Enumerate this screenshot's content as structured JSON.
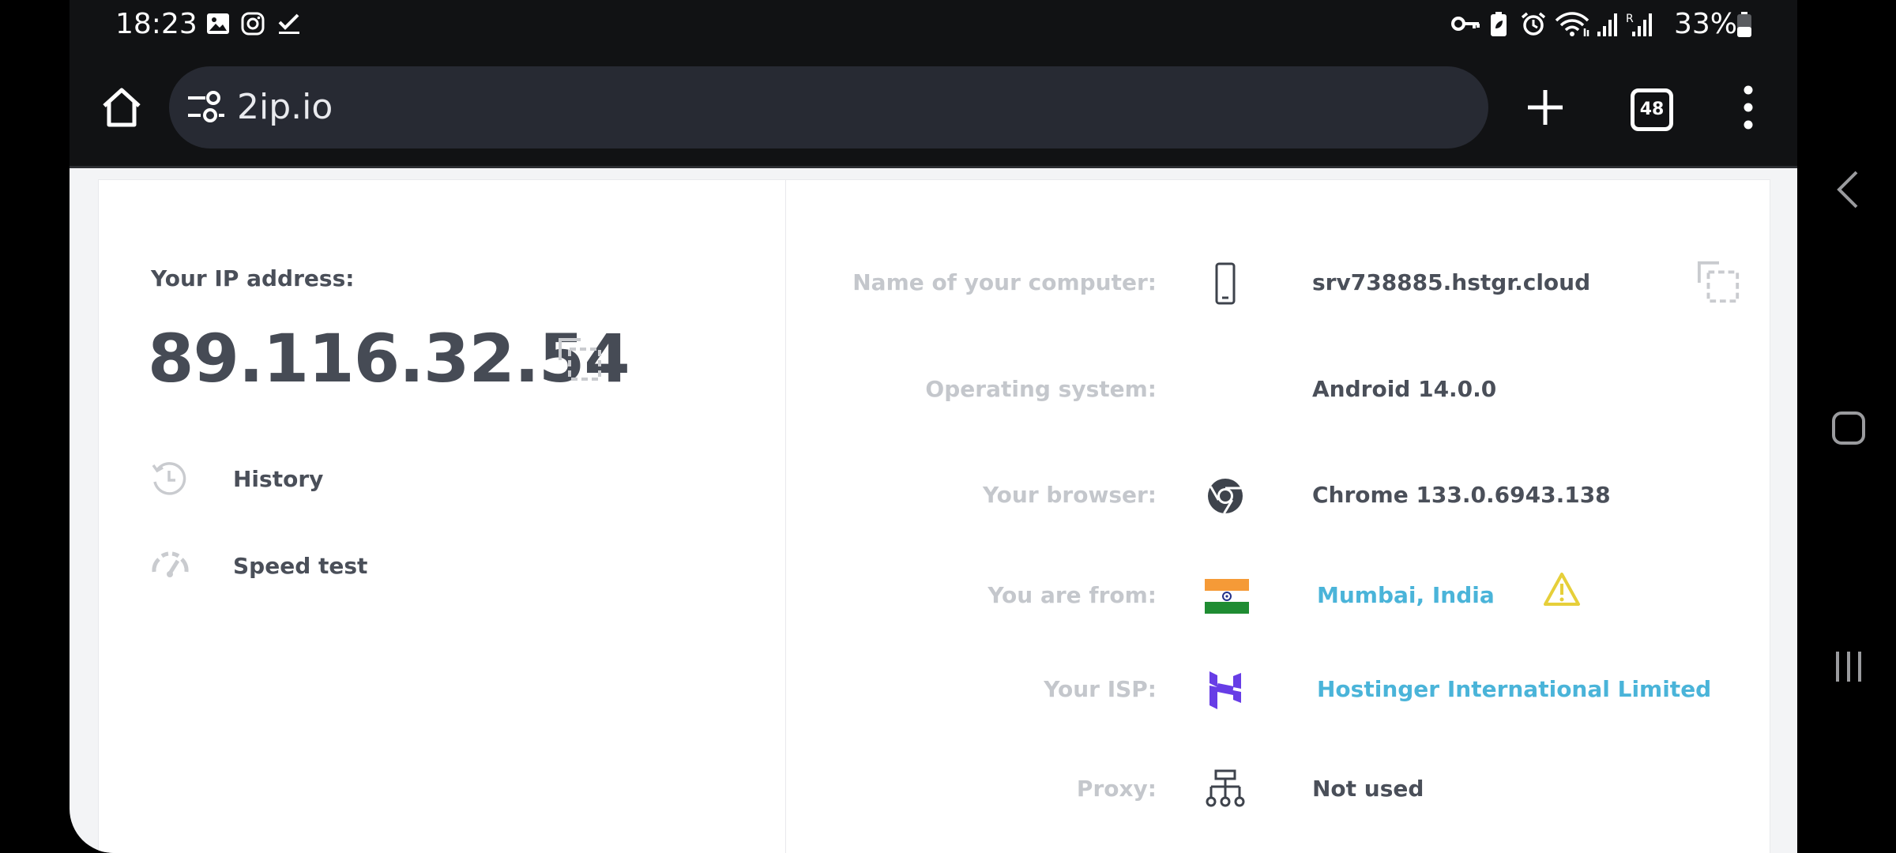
{
  "status_bar": {
    "time": "18:23",
    "battery": "33%",
    "icons": [
      "image-icon",
      "instagram-icon",
      "check-icon",
      "key-icon",
      "battery-saver-icon",
      "alarm-icon",
      "wifi-icon",
      "signal-icon",
      "signal-roaming-icon",
      "battery-icon"
    ]
  },
  "browser": {
    "url": "2ip.io",
    "tab_count": "48"
  },
  "ip_card": {
    "label": "Your IP address:",
    "ip": "89.116.32.54",
    "links": [
      {
        "label": "History",
        "icon": "history-icon"
      },
      {
        "label": "Speed test",
        "icon": "speedometer-icon"
      }
    ]
  },
  "details": {
    "computer": {
      "label": "Name of your computer:",
      "value": "srv738885.hstgr.cloud",
      "icon": "phone-icon"
    },
    "os": {
      "label": "Operating system:",
      "value": "Android 14.0.0"
    },
    "browser": {
      "label": "Your browser:",
      "value": "Chrome 133.0.6943.138",
      "icon": "chrome-icon"
    },
    "from": {
      "label": "You are from:",
      "value": "Mumbai, India",
      "icon": "india-flag-icon"
    },
    "isp": {
      "label": "Your ISP:",
      "value": "Hostinger International Limited",
      "icon": "hostinger-logo-icon"
    },
    "proxy": {
      "label": "Proxy:",
      "value": "Not used",
      "icon": "network-icon"
    }
  },
  "colors": {
    "link": "#4ab4d9",
    "warning": "#e6cf3a",
    "hostinger": "#673de6",
    "toolbar": "#111214"
  }
}
